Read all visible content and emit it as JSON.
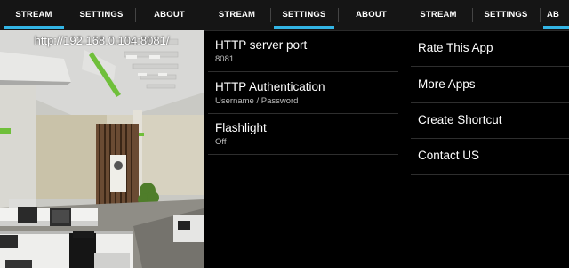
{
  "panels": [
    {
      "tabs": [
        "STREAM",
        "SETTINGS",
        "ABOUT"
      ],
      "active_tab": "STREAM",
      "stream_url": "http://192.168.0.104:8081/"
    },
    {
      "tabs": [
        "STREAM",
        "SETTINGS",
        "ABOUT"
      ],
      "active_tab": "SETTINGS",
      "settings": [
        {
          "title": "HTTP server port",
          "value": "8081"
        },
        {
          "title": "HTTP Authentication",
          "value": "Username / Password"
        },
        {
          "title": "Flashlight",
          "value": "Off"
        }
      ]
    },
    {
      "tabs": [
        "STREAM",
        "SETTINGS",
        "AB"
      ],
      "active_tab": "AB",
      "about_items": [
        "Rate This App",
        "More Apps",
        "Create Shortcut",
        "Contact US"
      ]
    }
  ],
  "colors": {
    "accent": "#33b5e5",
    "tabbar": "#151515",
    "background": "#000000"
  }
}
